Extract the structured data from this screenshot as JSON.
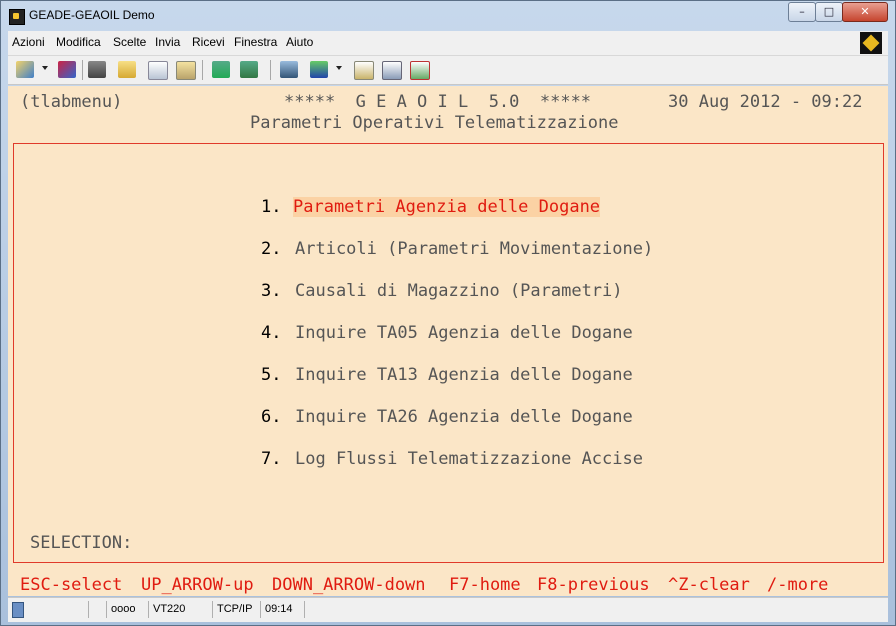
{
  "window": {
    "title": "GEADE-GEAOIL Demo",
    "controls": {
      "minimize": "–",
      "maximize": "□",
      "close": "✕"
    }
  },
  "menubar": {
    "items": [
      {
        "label": "Azioni"
      },
      {
        "label": "Modifica"
      },
      {
        "label": "Scelte"
      },
      {
        "label": "Invia"
      },
      {
        "label": "Ricevi"
      },
      {
        "label": "Finestra"
      },
      {
        "label": "Aiuto"
      }
    ]
  },
  "toolbar": {
    "icons": [
      "new-session-icon",
      "disconnect-icon",
      "print-icon",
      "open-folder-icon",
      "copy-icon",
      "paste-icon",
      "send-file-icon",
      "receive-file-icon",
      "book-icon",
      "font-icon",
      "settings-icon",
      "clipboard-icon",
      "macro-icon"
    ]
  },
  "terminal": {
    "program": "(tlabmenu)",
    "banner": "*****  G E A O I L  5.0  *****",
    "datetime": "30 Aug 2012 - 09:22",
    "subtitle": "Parametri Operativi Telematizzazione",
    "menu": [
      {
        "number": "1.",
        "label": "Parametri Agenzia delle Dogane",
        "selected": true
      },
      {
        "number": "2.",
        "label": "Articoli (Parametri Movimentazione)"
      },
      {
        "number": "3.",
        "label": "Causali di Magazzino (Parametri)"
      },
      {
        "number": "4.",
        "label": "Inquire TA05 Agenzia delle Dogane"
      },
      {
        "number": "5.",
        "label": "Inquire TA13 Agenzia delle Dogane"
      },
      {
        "number": "6.",
        "label": "Inquire TA26 Agenzia delle Dogane"
      },
      {
        "number": "7.",
        "label": "Log Flussi Telematizzazione Accise"
      }
    ],
    "selection_label": "SELECTION:",
    "keys": [
      "ESC-select",
      "UP_ARROW-up",
      "DOWN_ARROW-down",
      "F7-home",
      "F8-previous",
      "^Z-clear",
      "/-more"
    ],
    "colors": {
      "background": "#fbe6c7",
      "highlight": "#e01b10",
      "highlight_bg": "#fbd2a4",
      "text": "#555555"
    }
  },
  "statusbar": {
    "indicators": "oooo",
    "terminal_type": "VT220",
    "protocol": "TCP/IP",
    "time": "09:14"
  }
}
